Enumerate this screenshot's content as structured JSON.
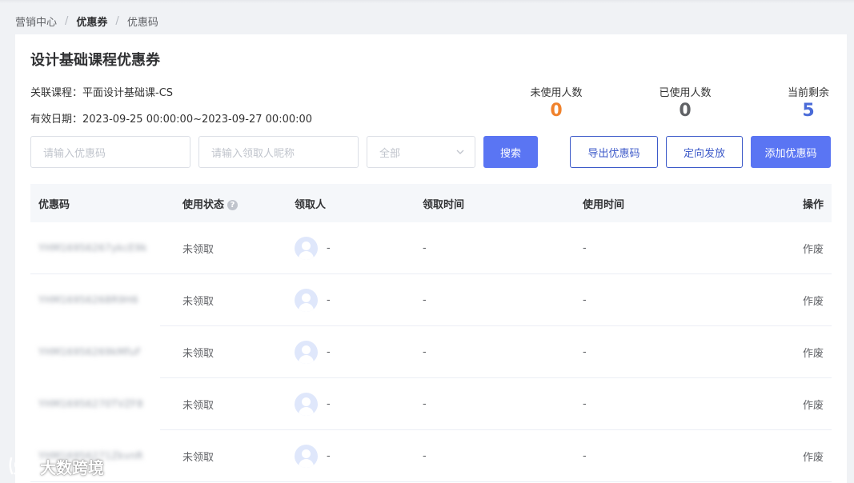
{
  "breadcrumb": {
    "items": [
      {
        "label": "营销中心",
        "bold": false
      },
      {
        "label": "优惠券",
        "bold": true
      },
      {
        "label": "优惠码",
        "bold": false
      }
    ],
    "separator": "/"
  },
  "page": {
    "title": "设计基础课程优惠券",
    "course_label": "关联课程：",
    "course_value": "平面设计基础课-CS",
    "date_label": "有效日期：",
    "date_value": "2023-09-25 00:00:00~2023-09-27 00:00:00"
  },
  "stats": [
    {
      "label": "未使用人数",
      "value": "0",
      "color": "#f0822c"
    },
    {
      "label": "已使用人数",
      "value": "0",
      "color": "#606266"
    },
    {
      "label": "当前剩余",
      "value": "5",
      "color": "#4a6bd8"
    }
  ],
  "filters": {
    "code_placeholder": "请输入优惠码",
    "nickname_placeholder": "请输入领取人昵称",
    "status_selected": "全部"
  },
  "buttons": {
    "search": "搜索",
    "export": "导出优惠码",
    "targeted": "定向发放",
    "add": "添加优惠码"
  },
  "table": {
    "columns": [
      "优惠码",
      "使用状态",
      "领取人",
      "领取时间",
      "使用时间",
      "操作"
    ],
    "help_icon": "question-circle-icon",
    "rows": [
      {
        "code": "YHM16956267ykcE9k",
        "status": "未领取",
        "receiver": "-",
        "receive_time": "-",
        "use_time": "-",
        "action": "作废"
      },
      {
        "code": "YHM16956268R9H6",
        "status": "未领取",
        "receiver": "-",
        "receive_time": "-",
        "use_time": "-",
        "action": "作废"
      },
      {
        "code": "YHM16956269kMfuF",
        "status": "未领取",
        "receiver": "-",
        "receive_time": "-",
        "use_time": "-",
        "action": "作废"
      },
      {
        "code": "YHM16956270TVZF8",
        "status": "未领取",
        "receiver": "-",
        "receive_time": "-",
        "use_time": "-",
        "action": "作废"
      },
      {
        "code": "YHM16956271ZkvnR",
        "status": "未领取",
        "receiver": "-",
        "receive_time": "-",
        "use_time": "-",
        "action": "作废"
      }
    ]
  },
  "watermark": {
    "text": "大数跨境"
  },
  "colors": {
    "primary": "#5a75f3",
    "link": "#4a6bd8",
    "orange": "#f0822c"
  }
}
